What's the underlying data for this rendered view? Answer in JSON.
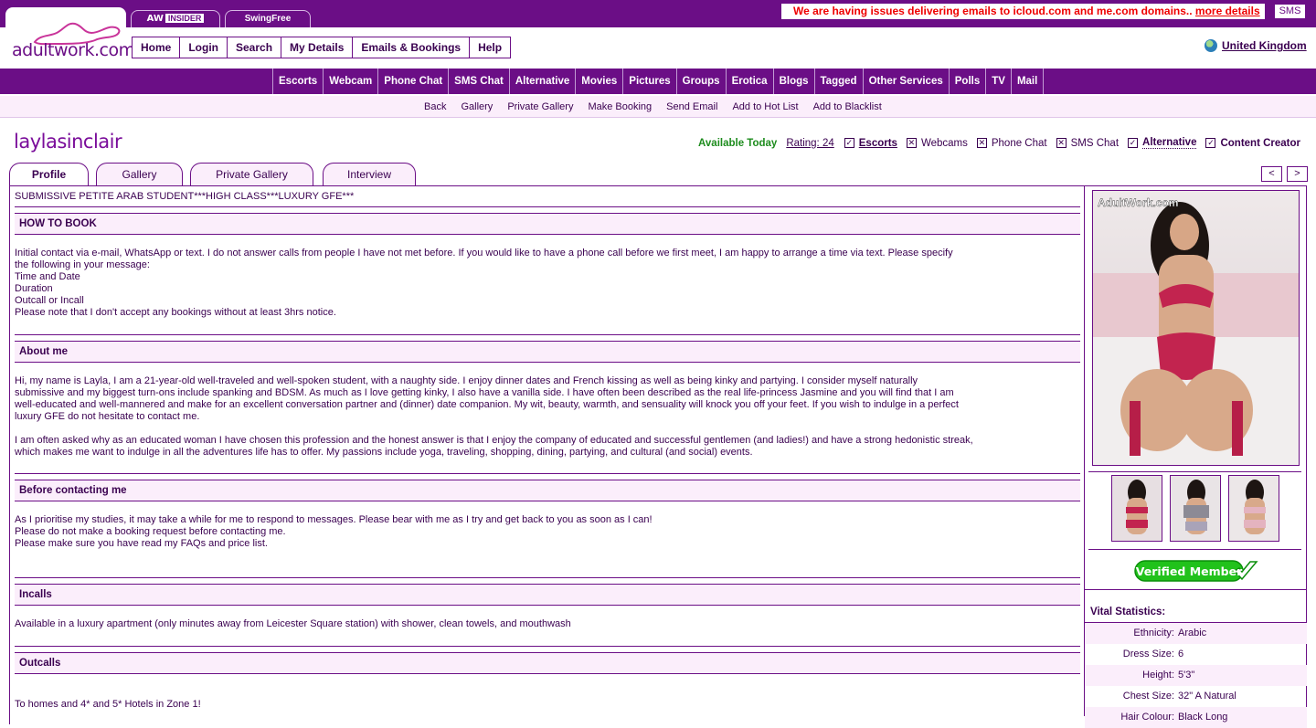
{
  "header": {
    "logo_text": "adultwork.com",
    "top_tabs": [
      {
        "aw": "AW",
        "label": "INSIDER"
      },
      {
        "label": "SwingFree"
      }
    ],
    "notice_text": "We are having issues delivering emails to icloud.com and me.com domains..",
    "notice_link": "more details",
    "sms_label": "SMS",
    "main_nav": [
      "Home",
      "Login",
      "Search",
      "My Details",
      "Emails & Bookings",
      "Help"
    ],
    "region": "United Kingdom"
  },
  "category_nav": [
    "Escorts",
    "Webcam",
    "Phone Chat",
    "SMS Chat",
    "Alternative",
    "Movies",
    "Pictures",
    "Groups",
    "Erotica",
    "Blogs",
    "Tagged",
    "Other Services",
    "Polls",
    "TV",
    "Mail"
  ],
  "sub_nav": [
    "Back",
    "Gallery",
    "Private Gallery",
    "Make Booking",
    "Send Email",
    "Add to Hot List",
    "Add to Blacklist"
  ],
  "profile": {
    "username": "laylasinclair",
    "availability": "Available Today",
    "rating": "Rating: 24",
    "services": [
      {
        "label": "Escorts",
        "checked": true
      },
      {
        "label": "Webcams",
        "checked": false
      },
      {
        "label": "Phone Chat",
        "checked": false
      },
      {
        "label": "SMS Chat",
        "checked": false
      },
      {
        "label": "Alternative",
        "checked": true
      },
      {
        "label": "Content Creator",
        "checked": true
      }
    ],
    "tabs": [
      "Profile",
      "Gallery",
      "Private Gallery",
      "Interview"
    ],
    "active_tab": "Profile",
    "prev_label": "<",
    "next_label": ">",
    "tagline": "SUBMISSIVE PETITE ARAB STUDENT***HIGH CLASS***LUXURY GFE***",
    "sections": [
      {
        "title": "HOW TO BOOK",
        "body": "Initial contact via e-mail, WhatsApp or text. I do not answer calls from people I have not met before. If you would like to have a phone call before we first meet, I am happy to arrange a time via text. Please specify\nthe following in your message:\nTime and Date\nDuration\nOutcall or Incall\nPlease note that I don't accept any bookings without at least 3hrs notice."
      },
      {
        "title": "About me",
        "body": "Hi, my name is Layla, I am a 21-year-old well-traveled and well-spoken student, with a naughty side. I enjoy dinner dates and French kissing as well as being kinky and partying. I consider myself naturally\nsubmissive and my biggest turn-ons include spanking and BDSM. As much as I love getting kinky, I also have a vanilla side. I have often been described as the real life-princess Jasmine and you will find that I am\nwell-educated and well-mannered and make for an excellent conversation partner and (dinner) date companion. My wit, beauty, warmth, and sensuality will knock you off your feet. If you wish to indulge in a perfect\nluxury GFE do not hesitate to contact me.\n\nI am often asked why as an educated woman I have chosen this profession and the honest answer is that I enjoy the company of educated and successful gentlemen (and ladies!) and have a strong hedonistic streak,\nwhich makes me want to indulge in all the adventures life has to offer. My passions include yoga, traveling, shopping, dining, partying, and cultural (and social) events."
      },
      {
        "title": "Before contacting me",
        "body": "As I prioritise my studies, it may take a while for me to respond to messages. Please bear with me as I try and get back to you as soon as I can!\nPlease do not make a booking request before contacting me.\nPlease make sure you have read my FAQs and price list."
      },
      {
        "title": "Incalls",
        "body": "Available in a luxury apartment (only minutes away from Leicester Square station) with shower, clean towels, and mouthwash"
      },
      {
        "title": "Outcalls",
        "body": "To homes and 4* and 5* Hotels in Zone 1!"
      }
    ]
  },
  "sidebar": {
    "photo_watermark": "AdultWork.com",
    "verified_label": "Verified Member",
    "vital_title": "Vital Statistics:",
    "vitals": [
      {
        "key": "Ethnicity:",
        "value": "Arabic"
      },
      {
        "key": "Dress Size:",
        "value": "6"
      },
      {
        "key": "Height:",
        "value": "5'3\""
      },
      {
        "key": "Chest Size:",
        "value": "32\" A Natural"
      },
      {
        "key": "Hair Colour:",
        "value": "Black Long"
      }
    ]
  }
}
